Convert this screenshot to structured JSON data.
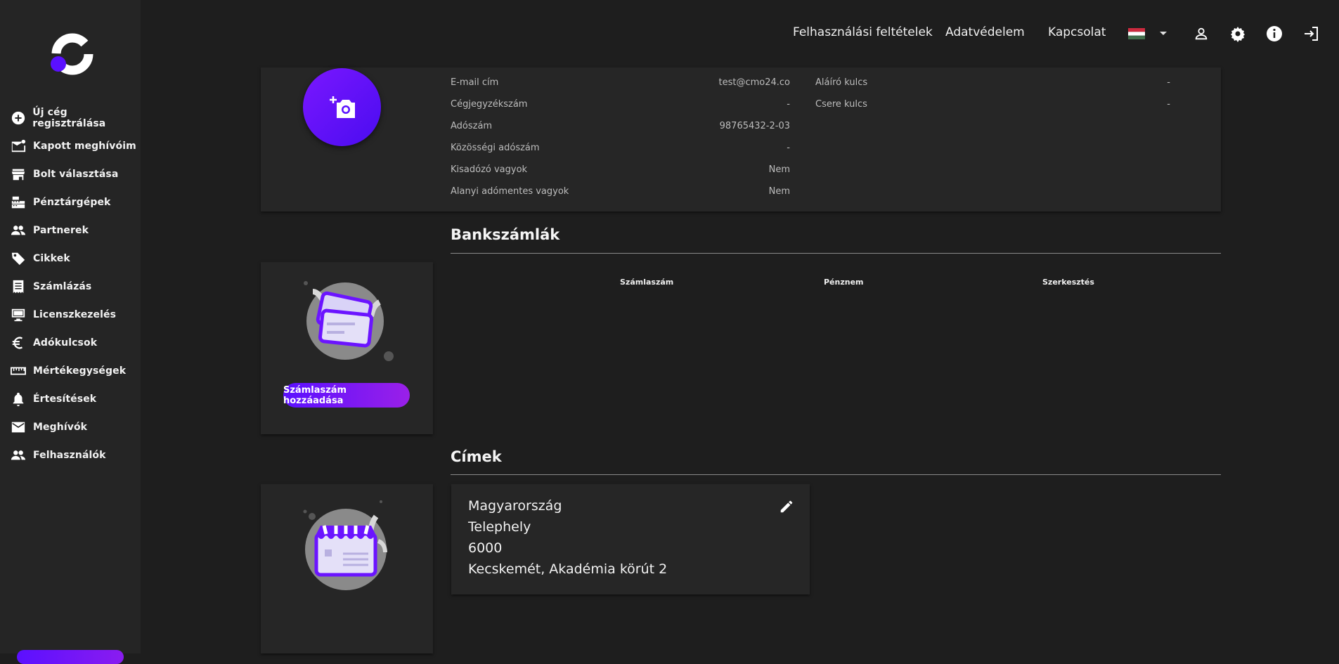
{
  "sidebar": {
    "items": [
      {
        "label": "Új cég regisztrálása",
        "icon": "add-circle-icon"
      },
      {
        "label": "Kapott meghívóim",
        "icon": "mail-notification-icon"
      },
      {
        "label": "Bolt választása",
        "icon": "store-icon"
      },
      {
        "label": "Pénztárgépek",
        "icon": "cash-register-icon"
      },
      {
        "label": "Partnerek",
        "icon": "people-icon"
      },
      {
        "label": "Cikkek",
        "icon": "tag-icon"
      },
      {
        "label": "Számlázás",
        "icon": "receipt-icon"
      },
      {
        "label": "Licenszkezelés",
        "icon": "monitor-icon"
      },
      {
        "label": "Adókulcsok",
        "icon": "euro-icon"
      },
      {
        "label": "Mértékegységek",
        "icon": "ruler-icon"
      },
      {
        "label": "Értesítések",
        "icon": "bell-icon"
      },
      {
        "label": "Meghívók",
        "icon": "mail-icon"
      },
      {
        "label": "Felhasználók",
        "icon": "users-icon"
      }
    ]
  },
  "topbar": {
    "terms": "Felhasználási feltételek",
    "privacy": "Adatvédelem",
    "contact": "Kapcsolat",
    "language_flag": "hungary-flag-icon"
  },
  "company": {
    "fields_left": [
      {
        "label": "E-mail cím",
        "value": "test@cmo24.co"
      },
      {
        "label": "Cégjegyzékszám",
        "value": "-"
      },
      {
        "label": "Adószám",
        "value": "98765432-2-03"
      },
      {
        "label": "Közösségi adószám",
        "value": "-"
      },
      {
        "label": "Kisadózó vagyok",
        "value": "Nem"
      },
      {
        "label": "Alanyi adómentes vagyok",
        "value": "Nem"
      }
    ],
    "fields_right": [
      {
        "label": "Aláíró kulcs",
        "value": "-"
      },
      {
        "label": "Csere kulcs",
        "value": "-"
      }
    ]
  },
  "bank": {
    "title": "Bankszámlák",
    "columns": [
      "Számlaszám",
      "Pénznem",
      "Szerkesztés"
    ],
    "add_button": "Számlaszám hozzáadása"
  },
  "addresses": {
    "title": "Címek",
    "card": {
      "country": "Magyarország",
      "type": "Telephely",
      "zip": "6000",
      "street": "Kecskemét, Akadémia körút 2"
    }
  },
  "colors": {
    "accent": "#5a10ff",
    "accent2": "#8a1cf0",
    "background": "#1e1e1e",
    "card": "#262626"
  }
}
